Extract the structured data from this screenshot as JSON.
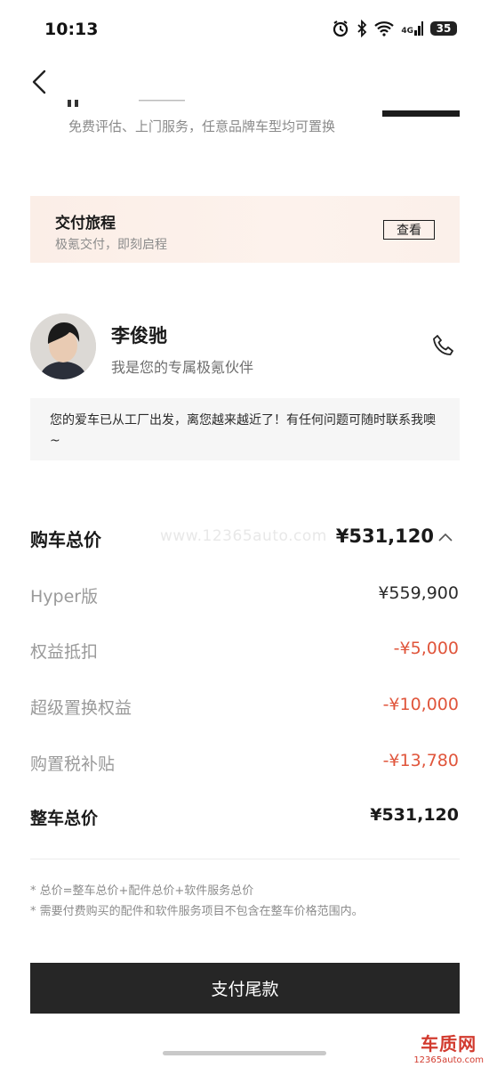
{
  "status": {
    "time": "10:13",
    "battery": "35",
    "network": "4G"
  },
  "service_note": "免费评估、上门服务，任意品牌车型均可置换",
  "delivery": {
    "title": "交付旅程",
    "subtitle": "极氪交付，即刻启程",
    "button": "查看"
  },
  "consultant": {
    "name": "李俊驰",
    "tagline": "我是您的专属极氪伙伴",
    "message": "您的爱车已从工厂出发，离您越来越近了！有任何问题可随时联系我噢~"
  },
  "price": {
    "total_label": "购车总价",
    "total_value": "¥531,120",
    "watermark": "www.12365auto.com",
    "rows": [
      {
        "label": "Hyper版",
        "value": "¥559,900"
      },
      {
        "label": "权益抵扣",
        "value": "-¥5,000"
      },
      {
        "label": "超级置换权益",
        "value": "-¥10,000"
      },
      {
        "label": "购置税补贴",
        "value": "-¥13,780"
      }
    ],
    "grand_label": "整车总价",
    "grand_value": "¥531,120"
  },
  "notes": [
    "* 总价=整车总价+配件总价+软件服务总价",
    "* 需要付费购买的配件和软件服务项目不包含在整车价格范围内。"
  ],
  "pay_button": "支付尾款",
  "site_logo": {
    "title": "车质网",
    "url": "12365auto.com"
  },
  "colors": {
    "discount_red": "#e0553b",
    "button_dark": "#262626",
    "delivery_bg": "#fbeee7"
  }
}
